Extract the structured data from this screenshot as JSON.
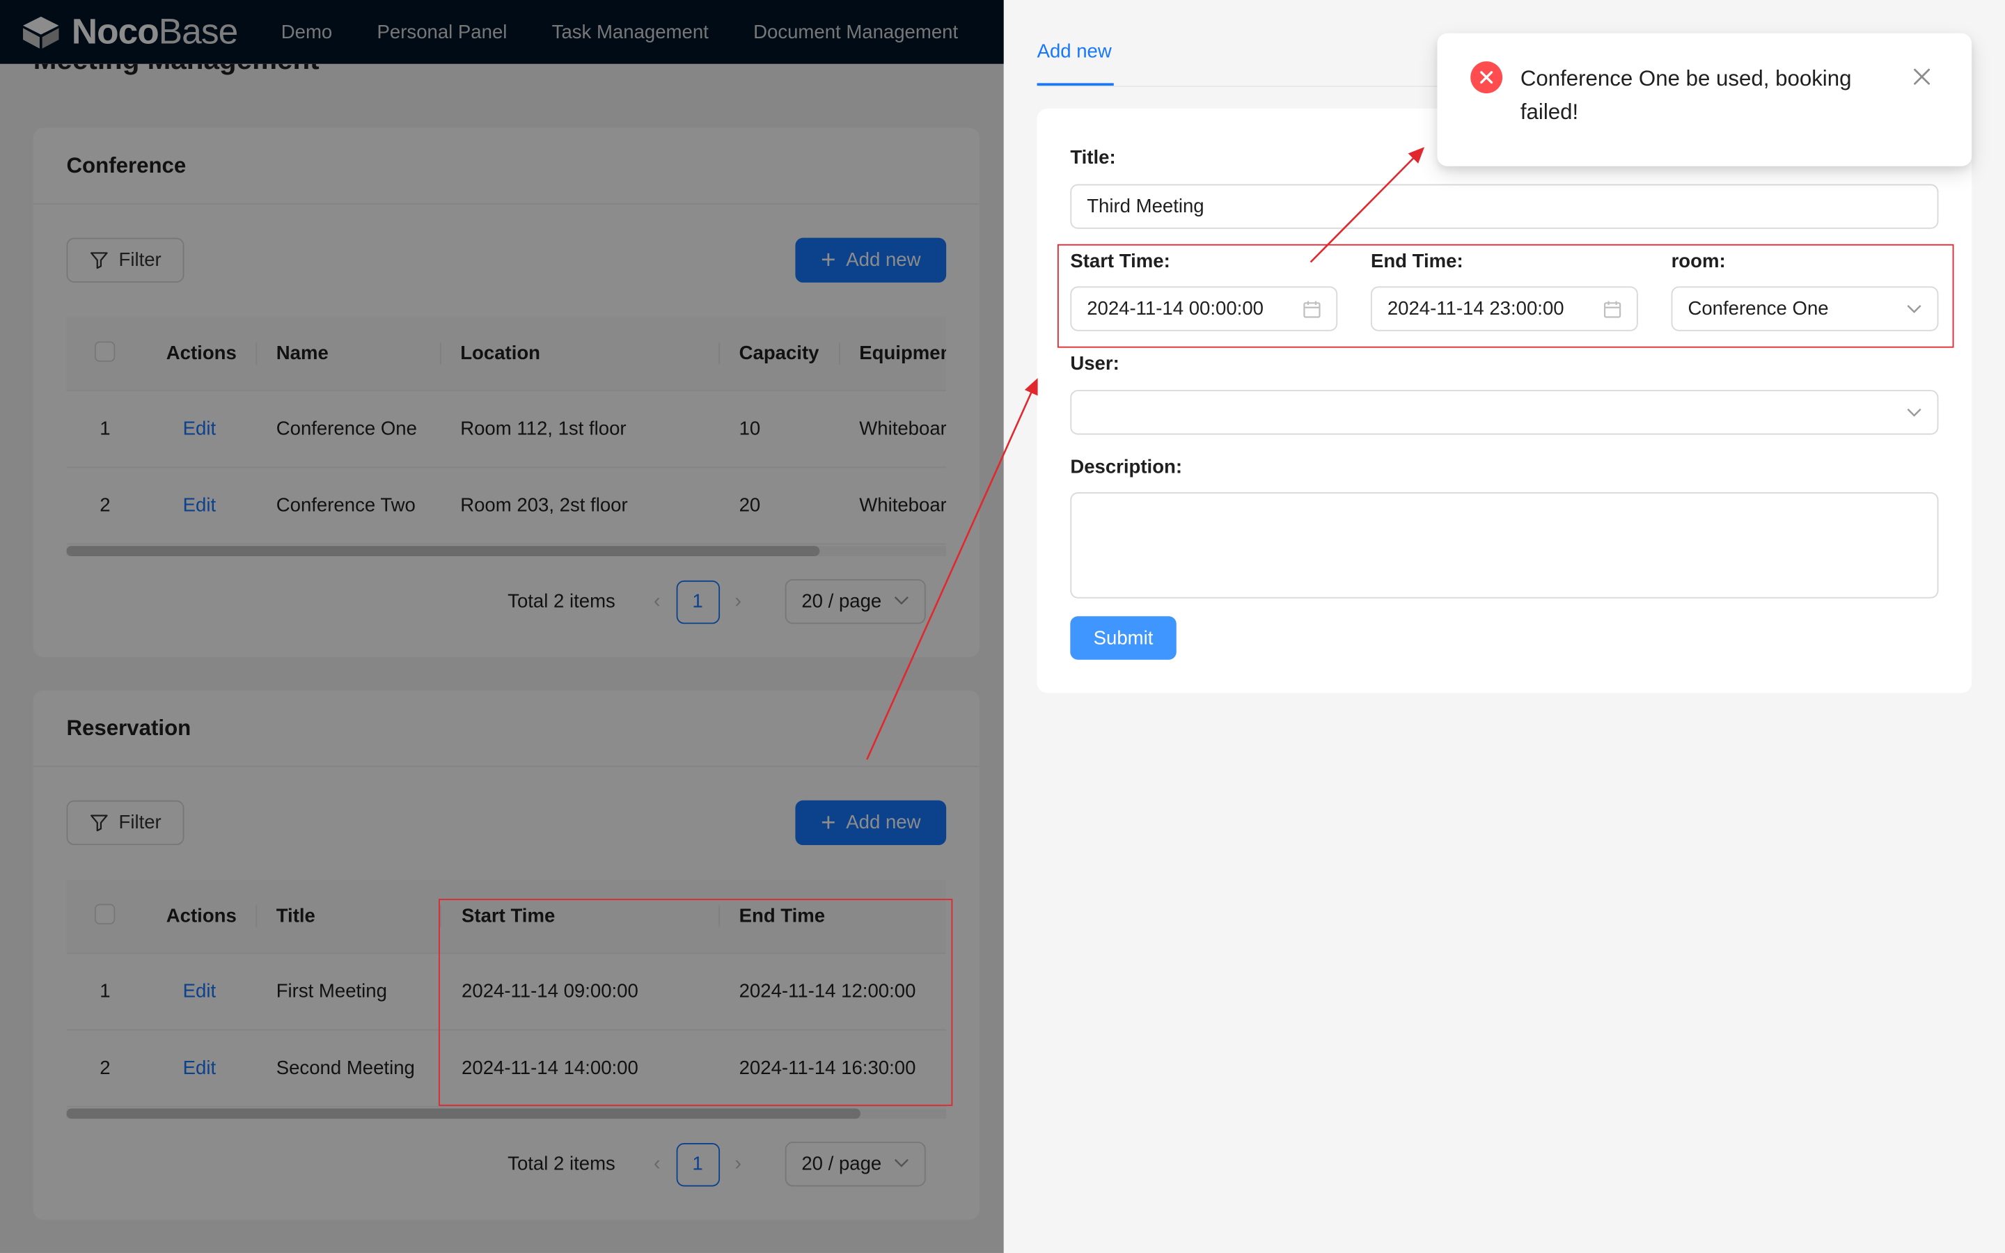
{
  "app": {
    "brand_bold": "Noco",
    "brand_thin": "Base",
    "nav": [
      "Demo",
      "Personal Panel",
      "Task Management",
      "Document Management"
    ],
    "page_title": "Meeting Management"
  },
  "conference": {
    "title": "Conference",
    "filter_label": "Filter",
    "add_label": "Add new",
    "columns": [
      "Actions",
      "Name",
      "Location",
      "Capacity",
      "Equipmen"
    ],
    "rows": [
      {
        "index": "1",
        "action": "Edit",
        "name": "Conference One",
        "location": "Room 112, 1st floor",
        "capacity": "10",
        "equipment": "Whiteboar"
      },
      {
        "index": "2",
        "action": "Edit",
        "name": "Conference Two",
        "location": "Room 203, 2st floor",
        "capacity": "20",
        "equipment": "Whiteboar"
      }
    ],
    "total": "Total 2 items",
    "page": "1",
    "page_size": "20 / page"
  },
  "reservation": {
    "title": "Reservation",
    "filter_label": "Filter",
    "add_label": "Add new",
    "columns": [
      "Actions",
      "Title",
      "Start Time",
      "End Time"
    ],
    "rows": [
      {
        "index": "1",
        "action": "Edit",
        "title": "First Meeting",
        "start": "2024-11-14 09:00:00",
        "end": "2024-11-14 12:00:00"
      },
      {
        "index": "2",
        "action": "Edit",
        "title": "Second Meeting",
        "start": "2024-11-14 14:00:00",
        "end": "2024-11-14 16:30:00"
      }
    ],
    "total": "Total 2 items",
    "page": "1",
    "page_size": "20 / page"
  },
  "drawer": {
    "tab": "Add new",
    "title_label": "Title",
    "title_value": "Third Meeting",
    "start_label": "Start Time",
    "start_value": "2024-11-14 00:00:00",
    "end_label": "End Time",
    "end_value": "2024-11-14 23:00:00",
    "room_label": "room",
    "room_value": "Conference One",
    "user_label": "User",
    "user_value": "",
    "description_label": "Description",
    "submit_label": "Submit"
  },
  "notification": {
    "message": "Conference One be used, booking failed!"
  },
  "colors": {
    "primary": "#1677ff",
    "error": "#ff4d4f",
    "annotation": "#e0282e",
    "topbar": "#001529"
  }
}
